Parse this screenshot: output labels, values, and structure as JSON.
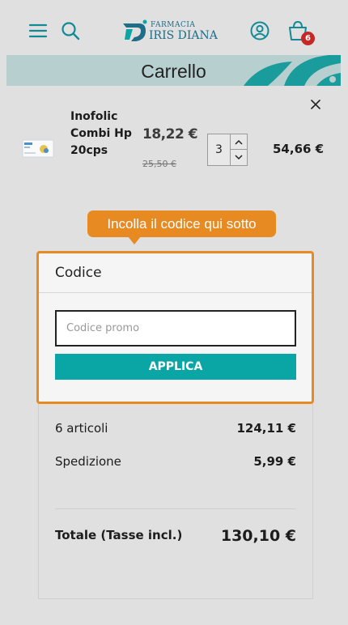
{
  "header": {
    "logo_small": "FARMACIA",
    "logo_big": "IRIS DIANA",
    "cart_count": "6",
    "accent": "#1f6d86"
  },
  "banner": {
    "title": "Carrello"
  },
  "cart_item": {
    "name": "Inofolic Combi Hp 20cps",
    "price": "18,22 €",
    "old_price": "25,50 €",
    "quantity": "3",
    "line_total": "54,66 €"
  },
  "tooltip": {
    "text": "Incolla il codice qui sotto"
  },
  "code_panel": {
    "title": "Codice",
    "placeholder": "Codice promo",
    "apply_label": "APPLICA"
  },
  "summary": {
    "items_label": "6 articoli",
    "items_value": "124,11 €",
    "shipping_label": "Spedizione",
    "shipping_value": "5,99 €",
    "total_label": "Totale (Tasse incl.)",
    "total_value": "130,10 €"
  },
  "colors": {
    "teal": "#0aa6a6",
    "highlight": "#e88a22",
    "badge": "#c62828",
    "banner": "#b8cfcf"
  }
}
